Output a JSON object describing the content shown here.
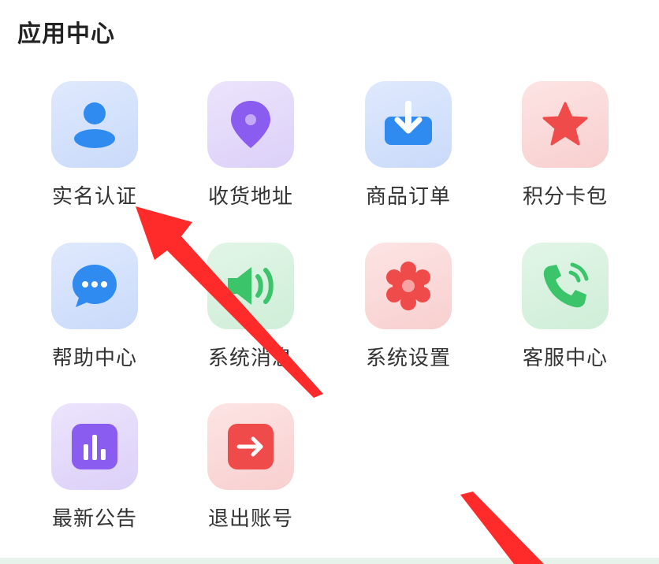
{
  "section": {
    "title": "应用中心"
  },
  "apps": [
    {
      "label": "实名认证",
      "icon": "user-icon",
      "tile_color": "#d6e4fb",
      "icon_color": "#2f8bf0"
    },
    {
      "label": "收货地址",
      "icon": "location-pin-icon",
      "tile_color": "#e7dcfb",
      "icon_color": "#8a5cf0"
    },
    {
      "label": "商品订单",
      "icon": "download-tray-icon",
      "tile_color": "#d6e4fb",
      "icon_color": "#2f8bf0"
    },
    {
      "label": "积分卡包",
      "icon": "star-icon",
      "tile_color": "#fbdada",
      "icon_color": "#ef4b4b"
    },
    {
      "label": "帮助中心",
      "icon": "chat-bubble-icon",
      "tile_color": "#d6e4fb",
      "icon_color": "#2f8bf0"
    },
    {
      "label": "系统消息",
      "icon": "speaker-icon",
      "tile_color": "#d7f0de",
      "icon_color": "#3cc46b"
    },
    {
      "label": "系统设置",
      "icon": "gear-icon",
      "tile_color": "#fbdada",
      "icon_color": "#ef4b4b"
    },
    {
      "label": "客服中心",
      "icon": "phone-icon",
      "tile_color": "#d7f0de",
      "icon_color": "#3cc46b"
    },
    {
      "label": "最新公告",
      "icon": "bar-chart-icon",
      "tile_color": "#e7dcfb",
      "icon_color": "#8a5cf0"
    },
    {
      "label": "退出账号",
      "icon": "exit-arrow-icon",
      "tile_color": "#fbdada",
      "icon_color": "#ef4b4b"
    }
  ],
  "annotation": {
    "arrow_color": "#ff2a2a"
  }
}
